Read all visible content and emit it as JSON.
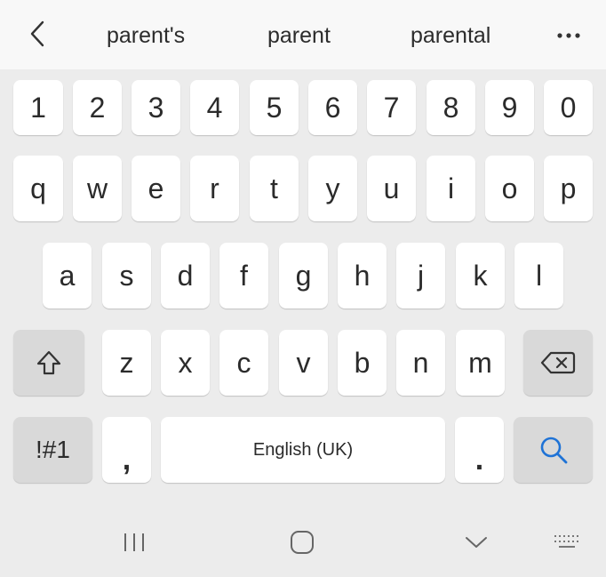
{
  "suggestions": {
    "back_icon": "chevron-left-icon",
    "items": [
      "parent's",
      "parent",
      "parental"
    ],
    "more_icon": "more-horizontal-icon"
  },
  "keyboard": {
    "number_row": [
      "1",
      "2",
      "3",
      "4",
      "5",
      "6",
      "7",
      "8",
      "9",
      "0"
    ],
    "row1": [
      "q",
      "w",
      "e",
      "r",
      "t",
      "y",
      "u",
      "i",
      "o",
      "p"
    ],
    "row2": [
      "a",
      "s",
      "d",
      "f",
      "g",
      "h",
      "j",
      "k",
      "l"
    ],
    "row3": [
      "z",
      "x",
      "c",
      "v",
      "b",
      "n",
      "m"
    ],
    "shift_icon": "shift-icon",
    "backspace_icon": "backspace-icon",
    "symbols_label": "!#1",
    "comma_label": ",",
    "space_label": "English (UK)",
    "period_label": ".",
    "search_icon": "search-icon",
    "accent_color": "#1f73d6",
    "key_color": "#ffffff",
    "function_key_color": "#d9d9d9"
  },
  "navigation": {
    "recents_icon": "recent-apps-icon",
    "home_icon": "home-icon",
    "hide_icon": "chevron-down-icon",
    "keyboard_icon": "keyboard-icon"
  }
}
